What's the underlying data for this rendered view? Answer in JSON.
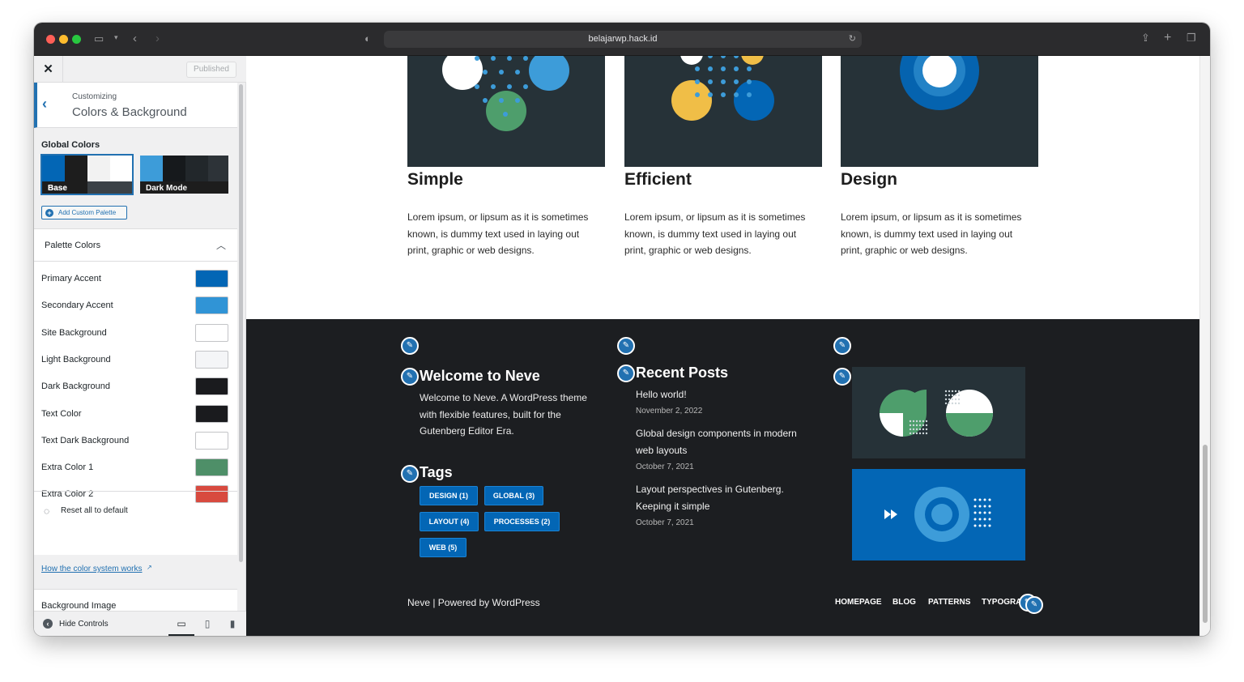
{
  "browser": {
    "url": "belajarwp.hack.id"
  },
  "sidebar": {
    "close_icon": "close-icon",
    "published_label": "Published",
    "customizing_label": "Customizing",
    "section_title": "Colors & Background",
    "global_colors_label": "Global Colors",
    "palettes": [
      {
        "name": "Base",
        "colors": [
          "#0366b5",
          "#1d1d1d",
          "#f2f2f2",
          "#ffffff",
          "#263238"
        ]
      },
      {
        "name": "Dark Mode",
        "colors": [
          "#3d9cd9",
          "#16191c",
          "#22272b",
          "#2d3338",
          "#1d1d1d"
        ]
      }
    ],
    "add_palette_label": "Add Custom Palette",
    "palette_colors_title": "Palette Colors",
    "colors": [
      {
        "label": "Primary Accent",
        "hex": "#0366b5"
      },
      {
        "label": "Secondary Accent",
        "hex": "#3094d6"
      },
      {
        "label": "Site Background",
        "hex": "#ffffff"
      },
      {
        "label": "Light Background",
        "hex": "#f4f5f7"
      },
      {
        "label": "Dark Background",
        "hex": "#1a1b1e"
      },
      {
        "label": "Text Color",
        "hex": "#1a1b1e"
      },
      {
        "label": "Text Dark Background",
        "hex": "#ffffff"
      },
      {
        "label": "Extra Color 1",
        "hex": "#4e8f68"
      },
      {
        "label": "Extra Color 2",
        "hex": "#d84a3f"
      }
    ],
    "reset_label": "Reset all to default",
    "howto_link": "How the color system works",
    "background_image_label": "Background Image",
    "hide_controls_label": "Hide Controls"
  },
  "preview": {
    "cards": [
      {
        "title": "Simple",
        "text": "Lorem ipsum, or lipsum as it is sometimes known, is dummy text used in laying out print, graphic or web designs."
      },
      {
        "title": "Efficient",
        "text": "Lorem ipsum, or lipsum as it is sometimes known, is dummy text used in laying out print, graphic or web designs."
      },
      {
        "title": "Design",
        "text": "Lorem ipsum, or lipsum as it is sometimes known, is dummy text used in laying out print, graphic or web designs."
      }
    ],
    "footer": {
      "welcome_title": "Welcome to Neve",
      "welcome_text": "Welcome to Neve. A WordPress theme with flexible features, built for the Gutenberg Editor Era.",
      "tags_title": "Tags",
      "tags": [
        "DESIGN (1)",
        "GLOBAL (3)",
        "LAYOUT (4)",
        "PROCESSES (2)",
        "WEB (5)"
      ],
      "recent_title": "Recent Posts",
      "posts": [
        {
          "title": "Hello world!",
          "date": "November 2, 2022"
        },
        {
          "title": "Global design components in modern web layouts",
          "date": "October 7, 2021"
        },
        {
          "title": "Layout perspectives in Gutenberg. Keeping it simple",
          "date": "October 7, 2021"
        }
      ],
      "copyright": "Neve | Powered by WordPress",
      "nav": [
        "HOMEPAGE",
        "BLOG",
        "PATTERNS",
        "TYPOGRA"
      ]
    }
  }
}
